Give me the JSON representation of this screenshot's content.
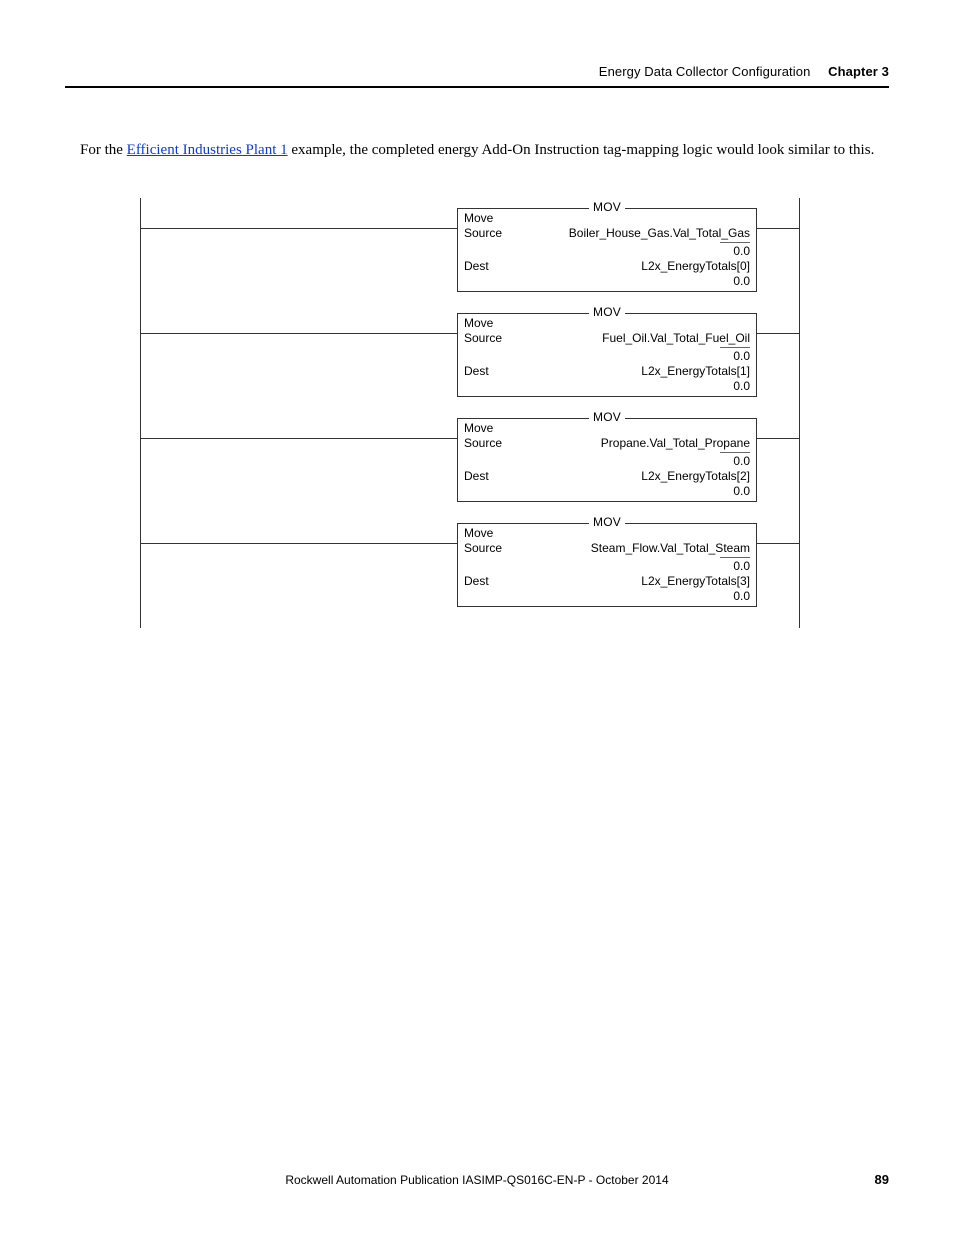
{
  "header": {
    "section": "Energy Data Collector Configuration",
    "chapter": "Chapter 3"
  },
  "para": {
    "pre": "For the ",
    "link": "Efficient Industries Plant 1",
    "post": " example, the completed energy Add-On Instruction tag-mapping logic would look similar to this."
  },
  "mov_title": "MOV",
  "blocks": [
    {
      "op": "Move",
      "src_lbl": "Source",
      "src": "Boiler_House_Gas.Val_Total_Gas",
      "src_val": "0.0",
      "dst_lbl": "Dest",
      "dst": "L2x_EnergyTotals[0]",
      "dst_val": "0.0"
    },
    {
      "op": "Move",
      "src_lbl": "Source",
      "src": "Fuel_Oil.Val_Total_Fuel_Oil",
      "src_val": "0.0",
      "dst_lbl": "Dest",
      "dst": "L2x_EnergyTotals[1]",
      "dst_val": "0.0"
    },
    {
      "op": "Move",
      "src_lbl": "Source",
      "src": "Propane.Val_Total_Propane",
      "src_val": "0.0",
      "dst_lbl": "Dest",
      "dst": "L2x_EnergyTotals[2]",
      "dst_val": "0.0"
    },
    {
      "op": "Move",
      "src_lbl": "Source",
      "src": "Steam_Flow.Val_Total_Steam",
      "src_val": "0.0",
      "dst_lbl": "Dest",
      "dst": "L2x_EnergyTotals[3]",
      "dst_val": "0.0"
    }
  ],
  "footer": {
    "publication": "Rockwell Automation Publication IASIMP-QS016C-EN-P - October 2014",
    "page": "89"
  }
}
